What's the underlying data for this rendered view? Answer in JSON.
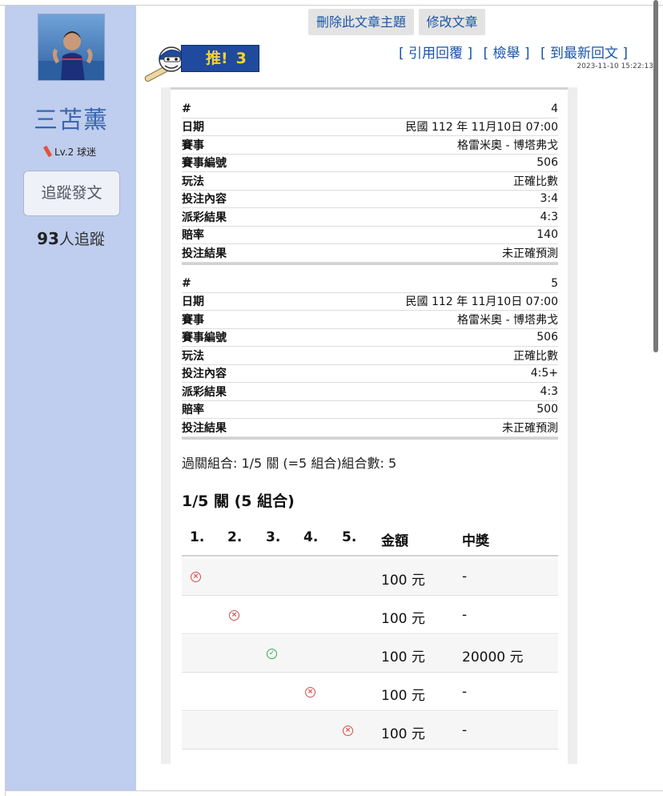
{
  "sidebar": {
    "user_name": "三苫薰",
    "level": "Lv.2 球迷",
    "follow_button": "追蹤發文",
    "follower_count": "93",
    "follower_suffix": "人追蹤"
  },
  "toolbar": {
    "delete_label": "刪除此文章主題",
    "edit_label": "修改文章",
    "push_label": "推!",
    "push_count": "3",
    "quote_reply": "[ 引用回覆 ]",
    "report": "[ 檢舉 ]",
    "latest_reply": "[ 到最新回文 ]",
    "timestamp": "2023-11-10 15:22:13"
  },
  "bets": [
    {
      "rows": [
        {
          "k": "#",
          "v": "4"
        },
        {
          "k": "日期",
          "v": "民國 112 年 11月10日 07:00"
        },
        {
          "k": "賽事",
          "v": "格雷米奧 - 博塔弗戈"
        },
        {
          "k": "賽事編號",
          "v": "506"
        },
        {
          "k": "玩法",
          "v": "正確比數"
        },
        {
          "k": "投注內容",
          "v": "3:4"
        },
        {
          "k": "派彩結果",
          "v": "4:3"
        },
        {
          "k": "賠率",
          "v": "140"
        },
        {
          "k": "投注結果",
          "v": "未正確預測"
        }
      ]
    },
    {
      "rows": [
        {
          "k": "#",
          "v": "5"
        },
        {
          "k": "日期",
          "v": "民國 112 年 11月10日 07:00"
        },
        {
          "k": "賽事",
          "v": "格雷米奧 - 博塔弗戈"
        },
        {
          "k": "賽事編號",
          "v": "506"
        },
        {
          "k": "玩法",
          "v": "正確比數"
        },
        {
          "k": "投注內容",
          "v": "4:5+"
        },
        {
          "k": "派彩結果",
          "v": "4:3"
        },
        {
          "k": "賠率",
          "v": "500"
        },
        {
          "k": "投注結果",
          "v": "未正確預測"
        }
      ]
    }
  ],
  "summary": "過關組合: 1/5 關 (=5 組合)組合數: 5",
  "combo_title": "1/5 關 (5 組合)",
  "combo_headers": [
    "1.",
    "2.",
    "3.",
    "4.",
    "5.",
    "金額",
    "中獎"
  ],
  "combos": [
    {
      "leg": 1,
      "result": "lose",
      "amount": "100 元",
      "prize": "-"
    },
    {
      "leg": 2,
      "result": "lose",
      "amount": "100 元",
      "prize": "-"
    },
    {
      "leg": 3,
      "result": "win",
      "amount": "100 元",
      "prize": "20000 元"
    },
    {
      "leg": 4,
      "result": "lose",
      "amount": "100 元",
      "prize": "-"
    },
    {
      "leg": 5,
      "result": "lose",
      "amount": "100 元",
      "prize": "-"
    }
  ],
  "colors": {
    "sidebar_bg": "#bfcdee",
    "link": "#1a55a8",
    "lose": "#d84a4a",
    "win": "#39a55a"
  }
}
